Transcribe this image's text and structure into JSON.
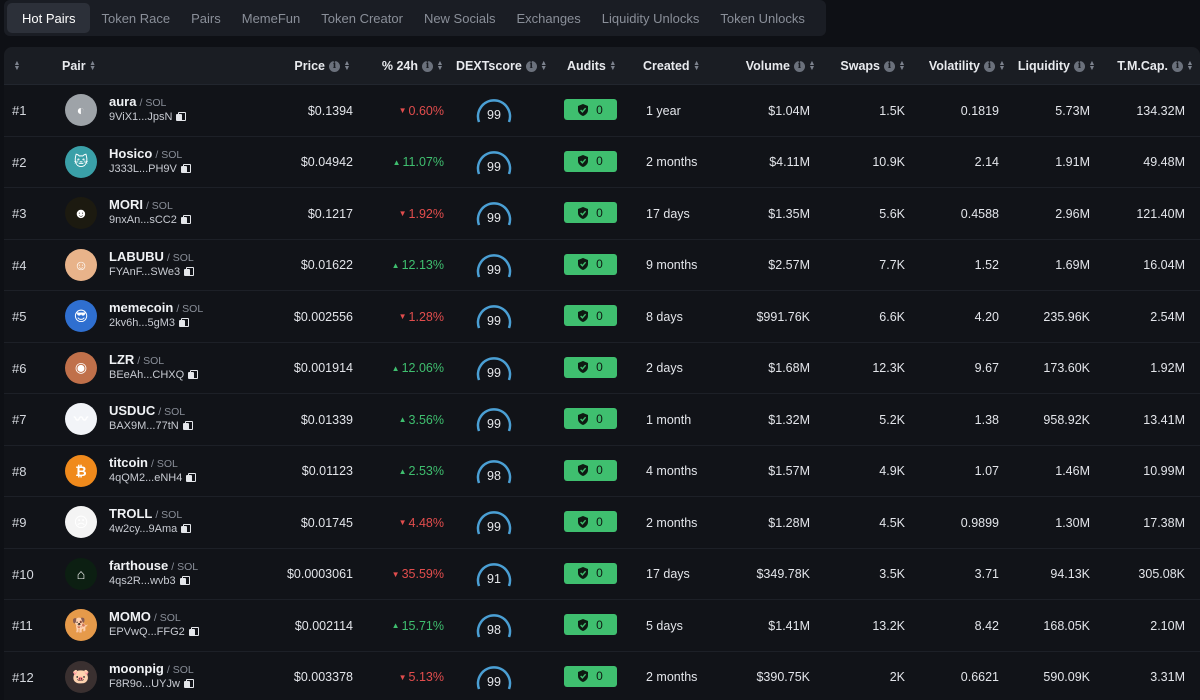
{
  "tabs": [
    "Hot Pairs",
    "Token Race",
    "Pairs",
    "MemeFun",
    "Token Creator",
    "New Socials",
    "Exchanges",
    "Liquidity Unlocks",
    "Token Unlocks"
  ],
  "active_tab": 0,
  "columns": {
    "pair": "Pair",
    "price": "Price",
    "change": "% 24h",
    "dextscore": "DEXTscore",
    "audits": "Audits",
    "created": "Created",
    "volume": "Volume",
    "swaps": "Swaps",
    "volatility": "Volatility",
    "liquidity": "Liquidity",
    "tmcap": "T.M.Cap."
  },
  "colors": {
    "up": "#3fbf6f",
    "down": "#e24d4d",
    "audit": "#3fbf6f",
    "gauge": "#4a9fd4"
  },
  "rows": [
    {
      "rank": "#1",
      "name": "aura",
      "chain": "SOL",
      "addr": "9ViX1...JpsN",
      "price": "$0.1394",
      "change": "0.60%",
      "dir": "down",
      "score": "99",
      "score_fill": 0.99,
      "audit": "0",
      "created": "1 year",
      "volume": "$1.04M",
      "swaps": "1.5K",
      "volatility": "0.1819",
      "liquidity": "5.73M",
      "tmcap": "134.32M",
      "avatar_icon": "aura-logo",
      "avatar_color": "#9ea3a8",
      "avatar_glyph": "◐"
    },
    {
      "rank": "#2",
      "name": "Hosico",
      "chain": "SOL",
      "addr": "J333L...PH9V",
      "price": "$0.04942",
      "change": "11.07%",
      "dir": "up",
      "score": "99",
      "score_fill": 0.99,
      "audit": "0",
      "created": "2 months",
      "volume": "$4.11M",
      "swaps": "10.9K",
      "volatility": "2.14",
      "liquidity": "1.91M",
      "tmcap": "49.48M",
      "avatar_icon": "hosico-logo",
      "avatar_color": "#3aa0a8",
      "avatar_glyph": "🐱"
    },
    {
      "rank": "#3",
      "name": "MORI",
      "chain": "SOL",
      "addr": "9nxAn...sCC2",
      "price": "$0.1217",
      "change": "1.92%",
      "dir": "down",
      "score": "99",
      "score_fill": 0.99,
      "audit": "0",
      "created": "17 days",
      "volume": "$1.35M",
      "swaps": "5.6K",
      "volatility": "0.4588",
      "liquidity": "2.96M",
      "tmcap": "121.40M",
      "avatar_icon": "mori-logo",
      "avatar_color": "#1c1a10",
      "avatar_glyph": "☻"
    },
    {
      "rank": "#4",
      "name": "LABUBU",
      "chain": "SOL",
      "addr": "FYAnF...SWe3",
      "price": "$0.01622",
      "change": "12.13%",
      "dir": "up",
      "score": "99",
      "score_fill": 0.99,
      "audit": "0",
      "created": "9 months",
      "volume": "$2.57M",
      "swaps": "7.7K",
      "volatility": "1.52",
      "liquidity": "1.69M",
      "tmcap": "16.04M",
      "avatar_icon": "labubu-logo",
      "avatar_color": "#e8b38a",
      "avatar_glyph": "☺"
    },
    {
      "rank": "#5",
      "name": "memecoin",
      "chain": "SOL",
      "addr": "2kv6h...5gM3",
      "price": "$0.002556",
      "change": "1.28%",
      "dir": "down",
      "score": "99",
      "score_fill": 0.99,
      "audit": "0",
      "created": "8 days",
      "volume": "$991.76K",
      "swaps": "6.6K",
      "volatility": "4.20",
      "liquidity": "235.96K",
      "tmcap": "2.54M",
      "avatar_icon": "memecoin-logo",
      "avatar_color": "#2f6fd0",
      "avatar_glyph": "😎"
    },
    {
      "rank": "#6",
      "name": "LZR",
      "chain": "SOL",
      "addr": "BEeAh...CHXQ",
      "price": "$0.001914",
      "change": "12.06%",
      "dir": "up",
      "score": "99",
      "score_fill": 0.99,
      "audit": "0",
      "created": "2 days",
      "volume": "$1.68M",
      "swaps": "12.3K",
      "volatility": "9.67",
      "liquidity": "173.60K",
      "tmcap": "1.92M",
      "avatar_icon": "lzr-logo",
      "avatar_color": "#c0704a",
      "avatar_glyph": "◉"
    },
    {
      "rank": "#7",
      "name": "USDUC",
      "chain": "SOL",
      "addr": "BAX9M...77tN",
      "price": "$0.01339",
      "change": "3.56%",
      "dir": "up",
      "score": "99",
      "score_fill": 0.99,
      "audit": "0",
      "created": "1 month",
      "volume": "$1.32M",
      "swaps": "5.2K",
      "volatility": "1.38",
      "liquidity": "958.92K",
      "tmcap": "13.41M",
      "avatar_icon": "usduc-logo",
      "avatar_color": "#f2f4f8",
      "avatar_glyph": "〰"
    },
    {
      "rank": "#8",
      "name": "titcoin",
      "chain": "SOL",
      "addr": "4qQM2...eNH4",
      "price": "$0.01123",
      "change": "2.53%",
      "dir": "up",
      "score": "98",
      "score_fill": 0.98,
      "audit": "0",
      "created": "4 months",
      "volume": "$1.57M",
      "swaps": "4.9K",
      "volatility": "1.07",
      "liquidity": "1.46M",
      "tmcap": "10.99M",
      "avatar_icon": "titcoin-logo",
      "avatar_color": "#f08a1c",
      "avatar_glyph": "₿"
    },
    {
      "rank": "#9",
      "name": "TROLL",
      "chain": "SOL",
      "addr": "4w2cy...9Ama",
      "price": "$0.01745",
      "change": "4.48%",
      "dir": "down",
      "score": "99",
      "score_fill": 0.99,
      "audit": "0",
      "created": "2 months",
      "volume": "$1.28M",
      "swaps": "4.5K",
      "volatility": "0.9899",
      "liquidity": "1.30M",
      "tmcap": "17.38M",
      "avatar_icon": "troll-logo",
      "avatar_color": "#f4f4f4",
      "avatar_glyph": "☹"
    },
    {
      "rank": "#10",
      "name": "farthouse",
      "chain": "SOL",
      "addr": "4qs2R...wvb3",
      "price": "$0.0003061",
      "change": "35.59%",
      "dir": "down",
      "score": "91",
      "score_fill": 0.91,
      "audit": "0",
      "created": "17 days",
      "volume": "$349.78K",
      "swaps": "3.5K",
      "volatility": "3.71",
      "liquidity": "94.13K",
      "tmcap": "305.08K",
      "avatar_icon": "farthouse-logo",
      "avatar_color": "#0c1f12",
      "avatar_glyph": "⌂"
    },
    {
      "rank": "#11",
      "name": "MOMO",
      "chain": "SOL",
      "addr": "EPVwQ...FFG2",
      "price": "$0.002114",
      "change": "15.71%",
      "dir": "up",
      "score": "98",
      "score_fill": 0.98,
      "audit": "0",
      "created": "5 days",
      "volume": "$1.41M",
      "swaps": "13.2K",
      "volatility": "8.42",
      "liquidity": "168.05K",
      "tmcap": "2.10M",
      "avatar_icon": "momo-logo",
      "avatar_color": "#e69a4a",
      "avatar_glyph": "🐕"
    },
    {
      "rank": "#12",
      "name": "moonpig",
      "chain": "SOL",
      "addr": "F8R9o...UYJw",
      "price": "$0.003378",
      "change": "5.13%",
      "dir": "down",
      "score": "99",
      "score_fill": 0.99,
      "audit": "0",
      "created": "2 months",
      "volume": "$390.75K",
      "swaps": "2K",
      "volatility": "0.6621",
      "liquidity": "590.09K",
      "tmcap": "3.31M",
      "avatar_icon": "moonpig-logo",
      "avatar_color": "#3a3030",
      "avatar_glyph": "🐷"
    }
  ]
}
